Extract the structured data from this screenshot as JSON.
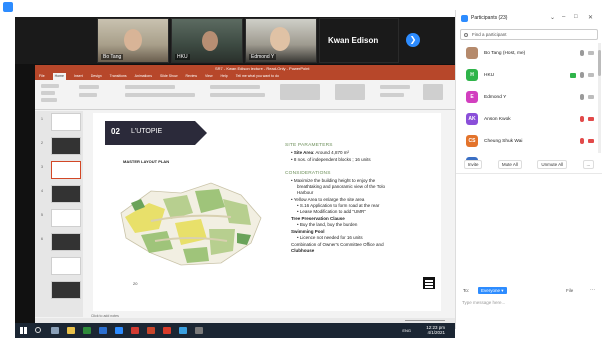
{
  "zoom": {
    "gallery": [
      {
        "label": "Bo Tang"
      },
      {
        "label": "HKU"
      },
      {
        "label": "Edmond Y"
      }
    ],
    "active_speaker": "Kwan Edison",
    "next_page_glyph": "❯"
  },
  "ppt": {
    "title": "SR7 - Kwan Edison lecture - Read-Only - PowerPoint",
    "tabs": [
      "File",
      "Home",
      "Insert",
      "Design",
      "Transitions",
      "Animations",
      "Slide Show",
      "Review",
      "View",
      "Help",
      "Tell me what you want to do"
    ],
    "active_tab": "Home",
    "thumbnail_numbers": [
      "1",
      "2",
      "3",
      "4",
      "5",
      "6"
    ],
    "notes_placeholder": "Click to add notes"
  },
  "slide": {
    "number": "02",
    "title": "L'UTOPIE",
    "plan_title": "MASTER LAYOUT PLAN",
    "page_number": "20",
    "site_parameters_heading": "SITE PARAMETERS",
    "site_area_label": "Site Area",
    "site_area_value": ": Around 4,870 m²",
    "blocks_text": "8 nos. of independent blocks ; 16 units",
    "considerations_heading": "CONSIDERATIONS",
    "c1": "Maximize the building height to enjoy the",
    "c1b": "breathtaking and panoramic view of the Tolo",
    "c1c": "Harbour",
    "c2": "Yellow Area to enlarge the site area",
    "c2a": "S.16 Application to form road at the rear",
    "c2b": "Lease Modification to add \"UMR\"",
    "c3": "Tree Preservation Clause",
    "c3a": "Buy the land, buy the burden",
    "c4": "Swimming Pool",
    "c4a": "Licence not needed for 16 units",
    "c5": "Combination of Owner's Committee Office and",
    "c5b": "Clubhouse"
  },
  "participants_panel": {
    "title": "Participants (23)",
    "window_controls": [
      "⌄",
      "–",
      "□",
      "✕"
    ],
    "search_placeholder": "Find a participant",
    "participants": [
      {
        "initials": "",
        "name": "Bo Tang (Host, me)",
        "color": "#b58a6c",
        "muted": false,
        "video": false
      },
      {
        "initials": "H",
        "name": "HKU",
        "color": "#2fb44a",
        "muted": false,
        "video": true
      },
      {
        "initials": "E",
        "name": "Edmond Y",
        "color": "#d23fbf",
        "muted": false,
        "video": false
      },
      {
        "initials": "AK",
        "name": "Anson Kwok",
        "color": "#8a4fd9",
        "muted": true,
        "video": true
      },
      {
        "initials": "CS",
        "name": "Cheung Shuk Wai",
        "color": "#e3732b",
        "muted": true,
        "video": true
      },
      {
        "initials": "",
        "name": "",
        "color": "#3a6fc4",
        "muted": false,
        "video": false
      }
    ],
    "invite_label": "Invite",
    "mute_all_label": "Mute All",
    "unmute_all_label": "Unmute All",
    "more_label": "..."
  },
  "chat": {
    "to_label": "To:",
    "recipient": "Everyone ▾",
    "file_label": "File",
    "more_label": "···",
    "input_placeholder": "Type message here..."
  },
  "taskbar": {
    "language": "ENG",
    "time": "12:23 pm",
    "date": "4/1/2021"
  }
}
